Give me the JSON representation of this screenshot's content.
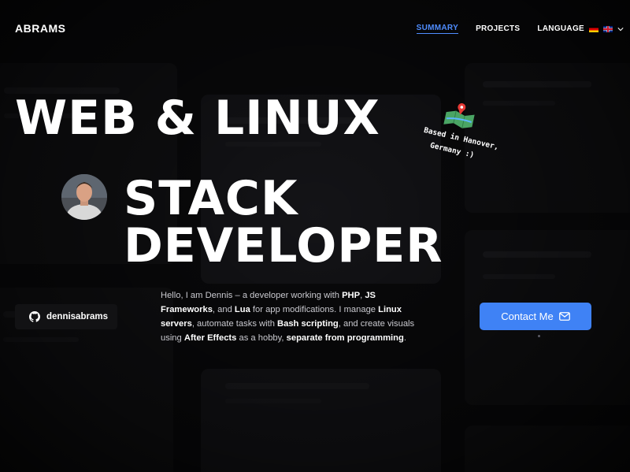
{
  "header": {
    "brand": "ABRAMS",
    "nav": {
      "summary": "SUMMARY",
      "projects": "PROJECTS",
      "language": "LANGUAGE"
    }
  },
  "hero": {
    "line1": "WEB & LINUX",
    "line2": "STACK DEVELOPER",
    "note_line1": "Based in Hanover,",
    "note_line2": "Germany :)"
  },
  "github": {
    "username": "dennisabrams"
  },
  "intro": {
    "p1": "Hello, I am Dennis – a developer working with ",
    "php": "PHP",
    "p2": ", ",
    "js": "JS Frameworks",
    "p3": ", and ",
    "lua": "Lua",
    "p4": " for app modifications. I manage ",
    "linux": "Linux servers",
    "p5": ", automate tasks with ",
    "bash": "Bash scripting",
    "p6": ", and create visuals using ",
    "ae": "After Effects",
    "p7": " as a hobby, ",
    "sep": "separate from programming",
    "p8": "."
  },
  "cta": {
    "contact_label": "Contact Me"
  },
  "icons": {
    "github": "github-icon",
    "mail": "mail-icon",
    "map": "map-pin-icon",
    "chevron": "chevron-down-icon",
    "flag_de": "flag-germany-icon",
    "flag_uk": "flag-uk-icon"
  },
  "colors": {
    "accent": "#3f82f5",
    "active_nav": "#4f8dff",
    "background": "#0b0b0d"
  }
}
